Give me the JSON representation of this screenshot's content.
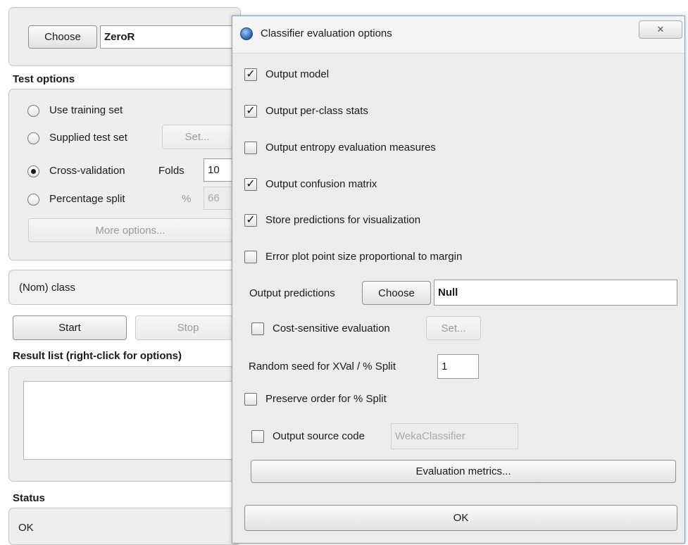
{
  "classifier": {
    "choose_label": "Choose",
    "name": "ZeroR"
  },
  "test_options": {
    "title": "Test options",
    "use_training": "Use training set",
    "supplied_test": "Supplied test set",
    "set_label": "Set...",
    "cross_validation": "Cross-validation",
    "folds_label": "Folds",
    "folds_value": "10",
    "percentage_split": "Percentage split",
    "percent_symbol": "%",
    "percent_value": "66",
    "more_options": "More options...",
    "selected": "cross_validation"
  },
  "class_select": "(Nom) class",
  "run": {
    "start": "Start",
    "stop": "Stop"
  },
  "result_list": {
    "title": "Result list (right-click for options)"
  },
  "status": {
    "title": "Status",
    "text": "OK"
  },
  "dialog": {
    "title": "Classifier evaluation options",
    "close_glyph": "✕",
    "check_glyph": "✓",
    "options": [
      {
        "label": "Output model",
        "checked": true
      },
      {
        "label": "Output per-class stats",
        "checked": true
      },
      {
        "label": "Output entropy evaluation measures",
        "checked": false
      },
      {
        "label": "Output confusion matrix",
        "checked": true
      },
      {
        "label": "Store predictions for visualization",
        "checked": true
      },
      {
        "label": "Error plot point size proportional to margin",
        "checked": false
      }
    ],
    "output_predictions_label": "Output predictions",
    "output_predictions_choose": "Choose",
    "output_predictions_value": "Null",
    "cost_sensitive": {
      "label": "Cost-sensitive evaluation",
      "checked": false,
      "set_label": "Set..."
    },
    "random_seed_label": "Random seed for XVal / % Split",
    "random_seed_value": "1",
    "preserve_order": {
      "label": "Preserve order for % Split",
      "checked": false
    },
    "output_source": {
      "label": "Output source code",
      "checked": false,
      "value": "WekaClassifier"
    },
    "evaluation_metrics": "Evaluation metrics...",
    "ok": "OK"
  }
}
